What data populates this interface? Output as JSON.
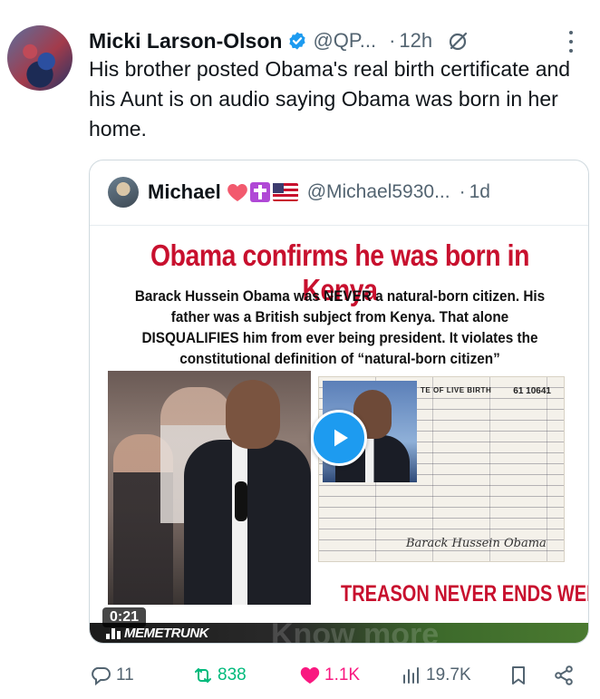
{
  "tweet": {
    "author_name": "Micki Larson-Olson",
    "handle": "@QP...",
    "separator": "·",
    "time": "12h",
    "text": "His brother posted Obama's real birth certificate and his Aunt is on audio saying Obama was born in her home."
  },
  "quote": {
    "author_name": "Michael",
    "handle": "@Michael5930...",
    "separator": "·",
    "time": "1d",
    "media": {
      "headline": "Obama confirms he was born in Kenya",
      "body": "Barack Hussein Obama was NEVER a natural-born citizen. His father was a British subject from Kenya. That alone DISQUALIFIES him from ever being president. It violates the constitutional definition of “natural-born citizen”",
      "footer": "TREASON NEVER ENDS WELL !!",
      "doc_title": "TE OF LIVE BIRTH",
      "doc_number": "61 10641",
      "doc_signature": "Barack Hussein Obama",
      "duration": "0:21",
      "watermark": "MEMETRUNK",
      "watermark_ghost": "Know more"
    }
  },
  "actions": {
    "replies": "11",
    "reposts": "838",
    "likes": "1.1K",
    "views": "19.7K"
  },
  "colors": {
    "text_primary": "#0f1419",
    "text_secondary": "#536471",
    "accent_blue": "#1d9bf0",
    "repost_green": "#00ba7c",
    "like_pink": "#f91880",
    "headline_red": "#c8102e"
  },
  "icons": [
    "verified-badge-icon",
    "grok-icon",
    "more-options-icon",
    "heart-emoji",
    "cross-emoji",
    "us-flag-emoji",
    "play-icon",
    "reply-icon",
    "repost-icon",
    "like-icon",
    "views-icon",
    "bookmark-icon",
    "share-icon"
  ]
}
